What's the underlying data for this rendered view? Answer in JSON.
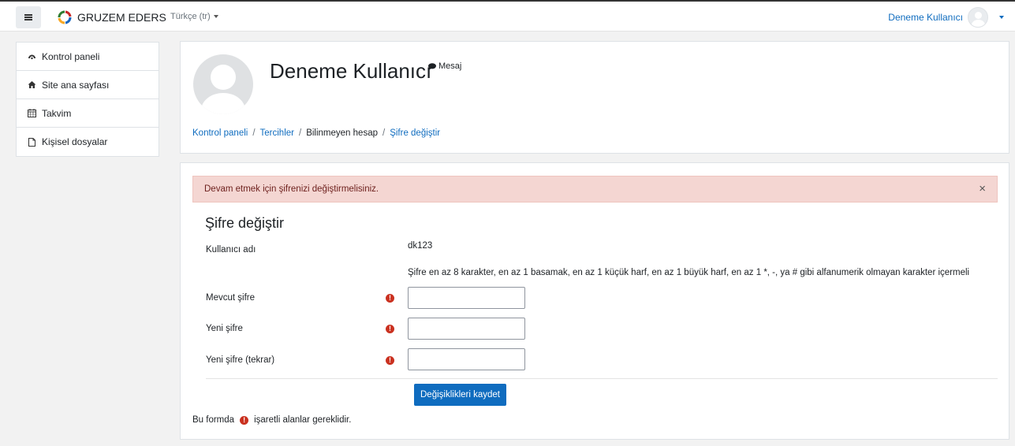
{
  "navbar": {
    "brand_name": "GRUZEM EDERS",
    "language": "Türkçe ‎(tr)‎",
    "user_name": "Deneme Kullanıcı"
  },
  "leftnav": {
    "items": [
      {
        "label": "Kontrol paneli",
        "icon": "dashboard-icon"
      },
      {
        "label": "Site ana sayfası",
        "icon": "home-icon"
      },
      {
        "label": "Takvim",
        "icon": "calendar-icon"
      },
      {
        "label": "Kişisel dosyalar",
        "icon": "file-icon"
      }
    ]
  },
  "header": {
    "profile_name": "Deneme Kullanıcı",
    "message_label": "Mesaj",
    "breadcrumb": [
      {
        "label": "Kontrol paneli",
        "link": true
      },
      {
        "label": "Tercihler",
        "link": true
      },
      {
        "label": "Bilinmeyen hesap",
        "link": false
      },
      {
        "label": "Şifre değiştir",
        "link": true
      }
    ],
    "separator": "/"
  },
  "main": {
    "alert_text": "Devam etmek için şifrenizi değiştirmelisiniz.",
    "alert_close": "×",
    "form_title": "Şifre değiştir",
    "username_label": "Kullanıcı adı",
    "username_value": "dk123",
    "policy_text": "Şifre en az 8 karakter, en az 1 basamak, en az 1 küçük harf, en az 1 büyük harf, en az 1 *, -, ya # gibi alfanumerik olmayan karakter içermeli",
    "fields": [
      {
        "label": "Mevcut şifre",
        "value": ""
      },
      {
        "label": "Yeni şifre",
        "value": ""
      },
      {
        "label": "Yeni şifre (tekrar)",
        "value": ""
      }
    ],
    "save_label": "Değişiklikleri kaydet",
    "required_note_before": "Bu formda",
    "required_note_after": "işaretli alanlar gereklidir.",
    "required_symbol": "!"
  },
  "colors": {
    "accent": "#0f6cbf",
    "alert_bg": "#f4d6d2",
    "required": "#ca3120"
  }
}
